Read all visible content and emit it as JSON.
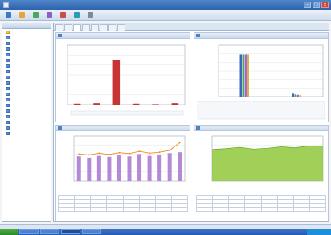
{
  "window": {
    "title": ""
  },
  "colors": {
    "accent": "#2e63ac",
    "bar_red": "#c83434",
    "area_green": "#8fc83a",
    "bar_purple": "#b48ad8",
    "line_orange": "#f08a1e"
  },
  "toolbar": {
    "buttons": [
      {
        "label": "",
        "icon": "home-icon"
      },
      {
        "label": "",
        "icon": "folder-icon"
      },
      {
        "label": "",
        "icon": "chart-icon"
      },
      {
        "label": "",
        "icon": "report-icon"
      },
      {
        "label": "",
        "icon": "settings-icon"
      },
      {
        "label": "",
        "icon": "help-icon"
      },
      {
        "label": "",
        "icon": "exit-icon"
      }
    ]
  },
  "sidebar": {
    "title": "",
    "items": [
      "",
      "",
      "",
      "",
      "",
      "",
      "",
      "",
      "",
      "",
      "",
      "",
      "",
      "",
      "",
      "",
      "",
      "",
      ""
    ]
  },
  "tabs": [
    "",
    "",
    "",
    "",
    "",
    "",
    "",
    ""
  ],
  "panels": {
    "tl": {
      "title": ""
    },
    "tr": {
      "title": ""
    },
    "bl": {
      "title": ""
    },
    "br": {
      "title": ""
    }
  },
  "status": {
    "left": "",
    "right": ""
  },
  "taskbar": {
    "start": "",
    "clock": ""
  },
  "chart_data": [
    {
      "type": "bar",
      "categories": [
        "1",
        "2",
        "3",
        "4",
        "5",
        "6"
      ],
      "values": [
        0.2,
        0.3,
        9.0,
        0.2,
        0.1,
        0.3
      ],
      "ylim": [
        0,
        12
      ]
    },
    {
      "type": "bar",
      "categories": [
        "1",
        "2"
      ],
      "series": [
        {
          "values": [
            11.5,
            0.8
          ]
        },
        {
          "values": [
            11.5,
            0.6
          ]
        },
        {
          "values": [
            11.5,
            0.5
          ]
        },
        {
          "values": [
            11.5,
            0.4
          ]
        }
      ],
      "ylim": [
        0,
        14
      ]
    },
    {
      "type": "bar",
      "categories": [
        "1",
        "2",
        "3",
        "4",
        "5",
        "6",
        "7",
        "8",
        "9",
        "10",
        "11"
      ],
      "values": [
        55,
        52,
        56,
        54,
        57,
        55,
        60,
        56,
        58,
        62,
        64
      ],
      "line": [
        60,
        58,
        62,
        59,
        63,
        61,
        66,
        62,
        64,
        68,
        85
      ],
      "ylim": [
        0,
        100
      ]
    },
    {
      "type": "area",
      "categories": [
        "1",
        "2",
        "3",
        "4",
        "5",
        "6",
        "7",
        "8",
        "9"
      ],
      "values": [
        70,
        72,
        75,
        71,
        73,
        76,
        74,
        78,
        77
      ],
      "ylim": [
        0,
        100
      ]
    }
  ]
}
